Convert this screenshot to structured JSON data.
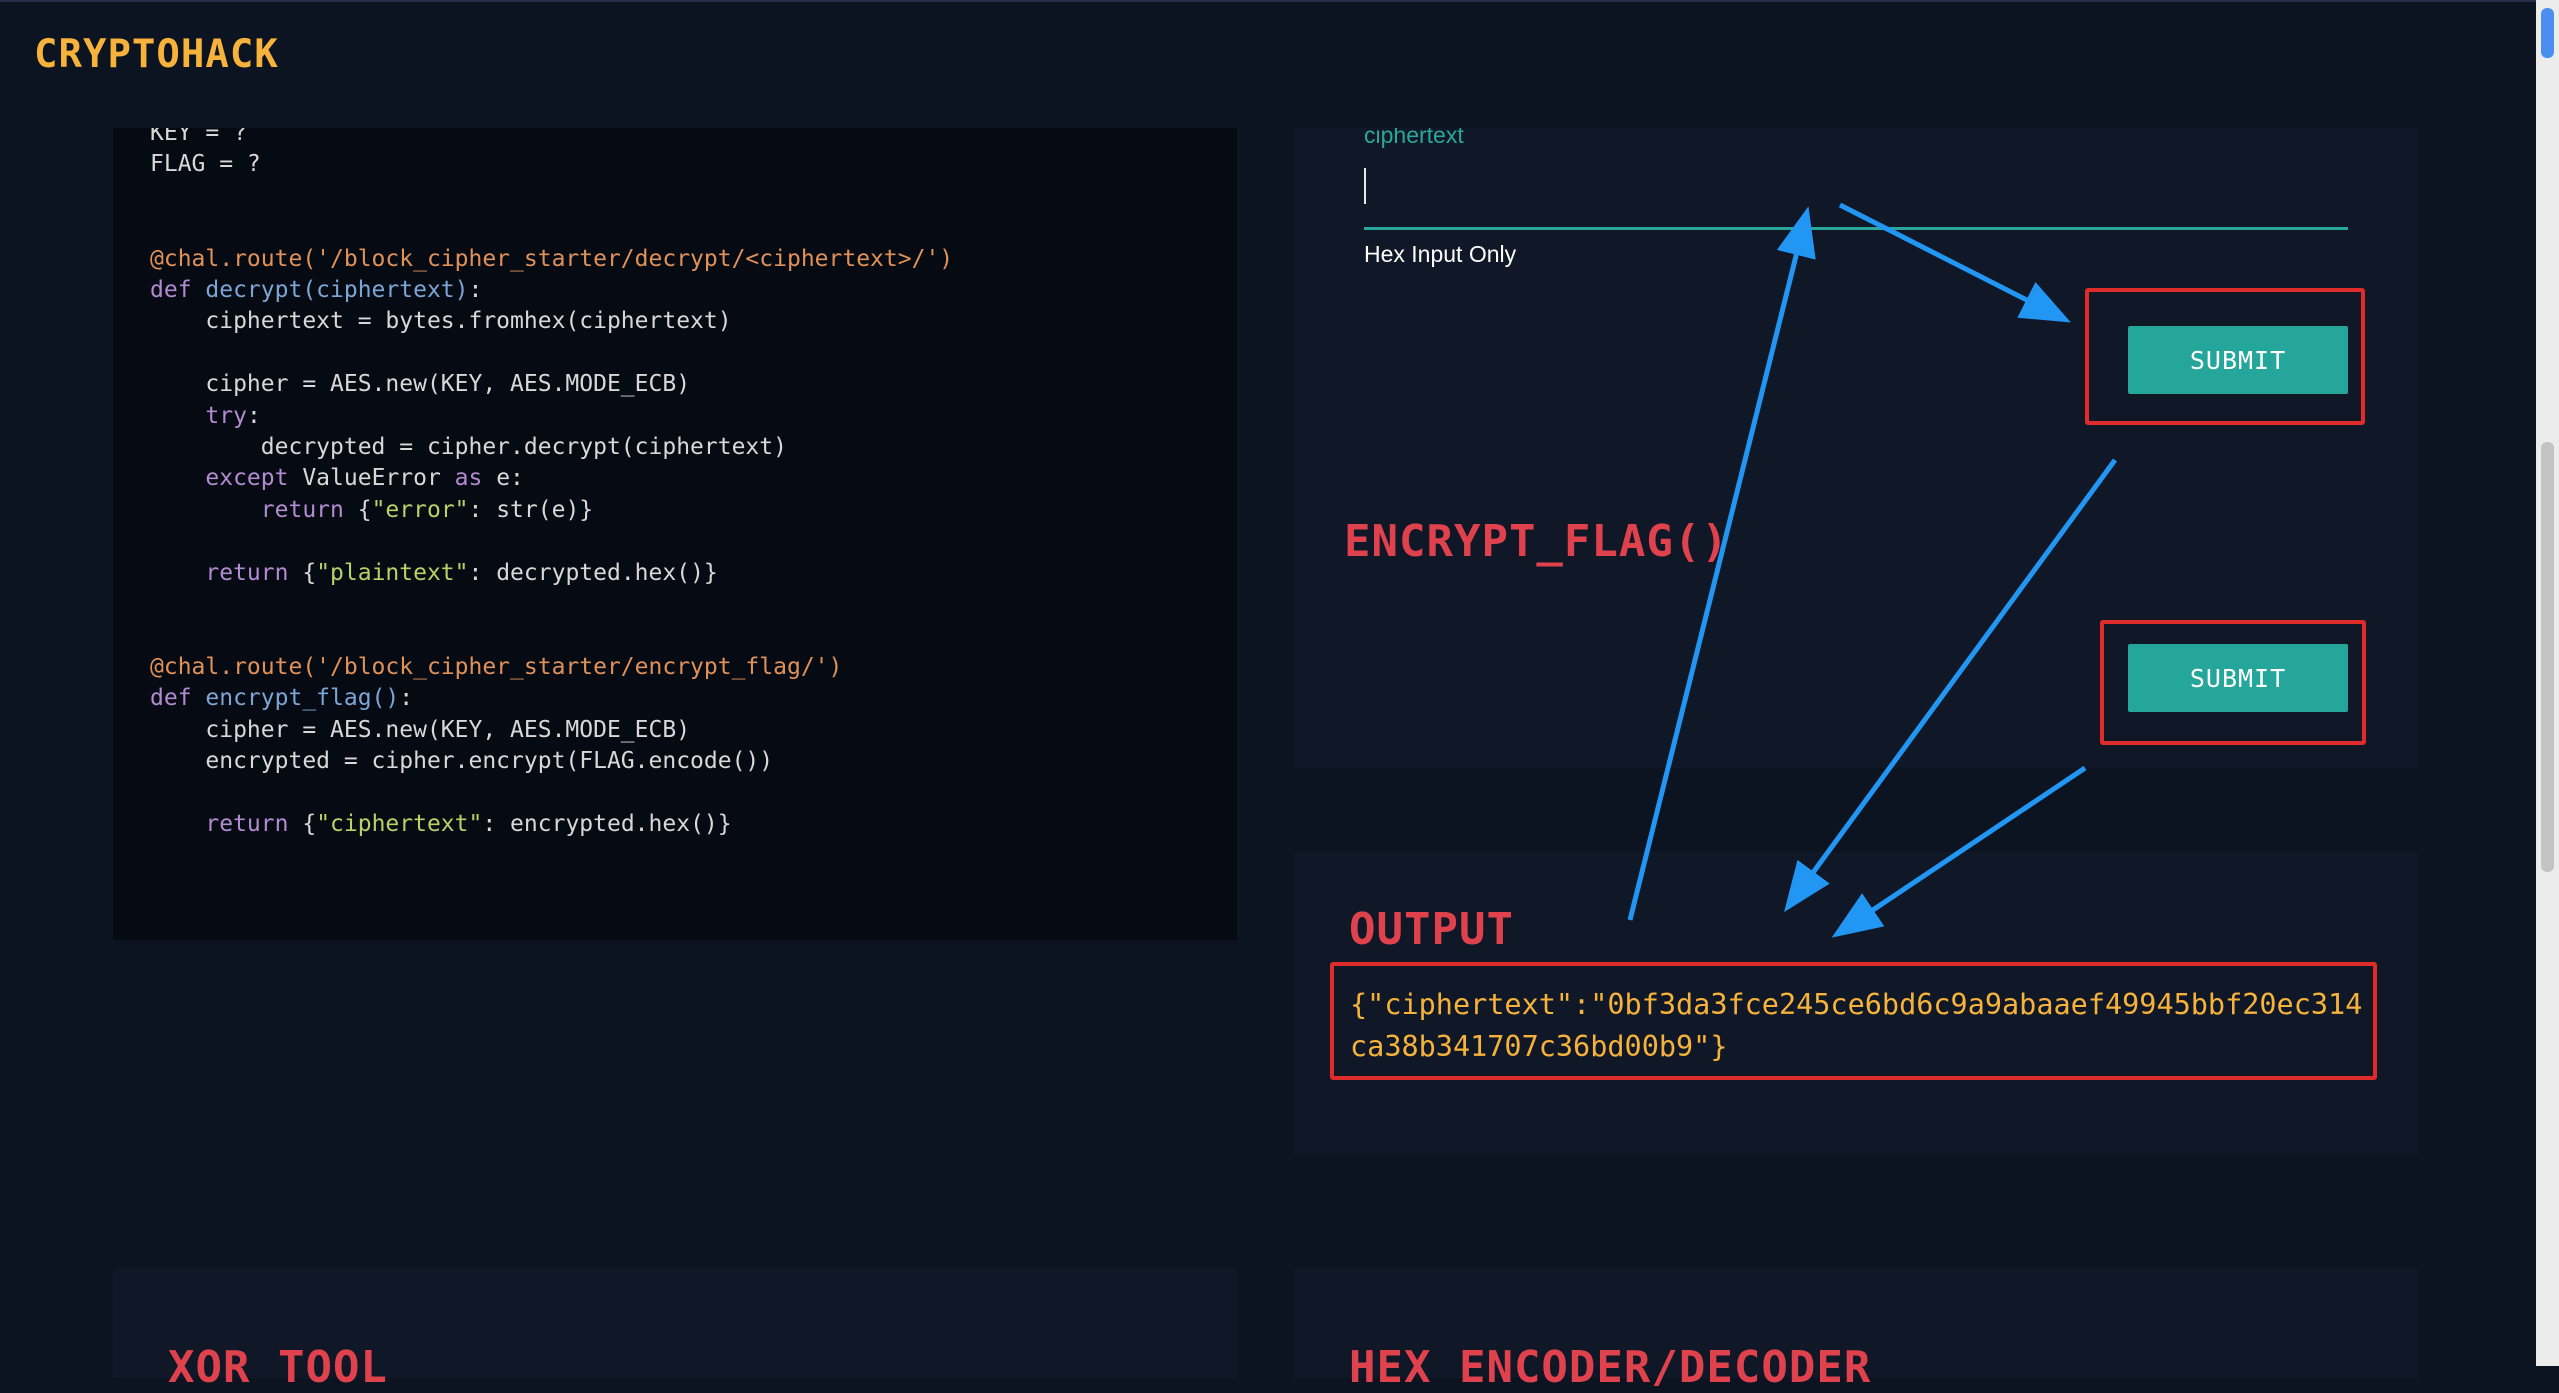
{
  "navbar": {
    "brand": "CRYPTOHACK"
  },
  "code": {
    "lines": [
      [
        {
          "t": "KEY = ?"
        }
      ],
      [
        {
          "t": "FLAG = ?"
        }
      ],
      [],
      [],
      [
        {
          "t": "@chal.route('/block_cipher_starter/decrypt/<ciphertext>/')",
          "c": "dec"
        }
      ],
      [
        {
          "t": "def ",
          "c": "kw"
        },
        {
          "t": "decrypt(ciphertext)",
          "c": "fn"
        },
        {
          "t": ":"
        }
      ],
      [
        {
          "t": "    ciphertext = bytes.fromhex(ciphertext)"
        }
      ],
      [],
      [
        {
          "t": "    cipher = AES.new(KEY, AES.MODE_ECB)"
        }
      ],
      [
        {
          "t": "    "
        },
        {
          "t": "try",
          "c": "kw"
        },
        {
          "t": ":"
        }
      ],
      [
        {
          "t": "        decrypted = cipher.decrypt(ciphertext)"
        }
      ],
      [
        {
          "t": "    "
        },
        {
          "t": "except",
          "c": "kw"
        },
        {
          "t": " ValueError "
        },
        {
          "t": "as",
          "c": "kw"
        },
        {
          "t": " e:"
        }
      ],
      [
        {
          "t": "        "
        },
        {
          "t": "return",
          "c": "kw"
        },
        {
          "t": " {"
        },
        {
          "t": "\"error\"",
          "c": "str"
        },
        {
          "t": ": str(e)}"
        }
      ],
      [],
      [
        {
          "t": "    "
        },
        {
          "t": "return",
          "c": "kw"
        },
        {
          "t": " {"
        },
        {
          "t": "\"plaintext\"",
          "c": "str"
        },
        {
          "t": ": decrypted.hex()}"
        }
      ],
      [],
      [],
      [
        {
          "t": "@chal.route('/block_cipher_starter/encrypt_flag/')",
          "c": "dec"
        }
      ],
      [
        {
          "t": "def ",
          "c": "kw"
        },
        {
          "t": "encrypt_flag()",
          "c": "fn"
        },
        {
          "t": ":"
        }
      ],
      [
        {
          "t": "    cipher = AES.new(KEY, AES.MODE_ECB)"
        }
      ],
      [
        {
          "t": "    encrypted = cipher.encrypt(FLAG.encode())"
        }
      ],
      [],
      [
        {
          "t": "    "
        },
        {
          "t": "return",
          "c": "kw"
        },
        {
          "t": " {"
        },
        {
          "t": "\"ciphertext\"",
          "c": "str"
        },
        {
          "t": ": encrypted.hex()}"
        }
      ]
    ]
  },
  "decrypt_form": {
    "field_label": "ciphertext",
    "input_value": "",
    "hint": "Hex Input Only",
    "submit_label": "SUBMIT"
  },
  "encrypt_flag": {
    "heading": "ENCRYPT_FLAG()",
    "submit_label": "SUBMIT"
  },
  "output": {
    "heading": "OUTPUT",
    "text": "{\"ciphertext\":\"0bf3da3fce245ce6bd6c9a9abaaef49945bbf20ec314ca38b341707c36bd00b9\"}"
  },
  "bottom_panels": {
    "xor_heading": "XOR TOOL",
    "hex_heading": "HEX ENCODER/DECODER"
  },
  "colors": {
    "background": "#0c1321",
    "brand": "#f6b23a",
    "accent": "#24a69a",
    "heading": "#e0424d",
    "annotation_box": "#e02b2b",
    "annotation_arrow": "#2196f3"
  }
}
